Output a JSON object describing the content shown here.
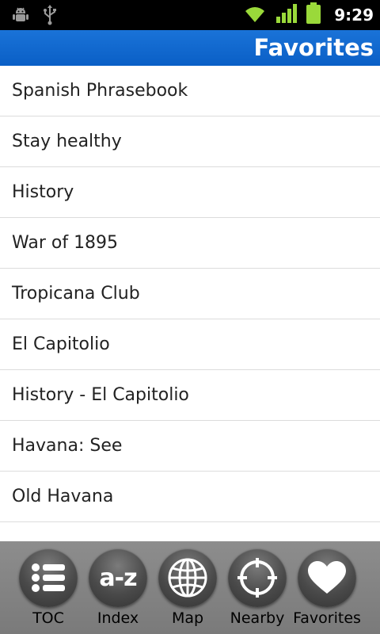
{
  "status_bar": {
    "time": "9:29",
    "icons_left": [
      "android-debug-icon",
      "usb-icon"
    ],
    "icons_right": [
      "wifi-icon",
      "signal-icon",
      "battery-icon"
    ]
  },
  "header": {
    "title": "Favorites"
  },
  "favorites": [
    "Spanish Phrasebook",
    "Stay healthy",
    "History",
    "War of 1895",
    "Tropicana Club",
    "El Capitolio",
    "History - El Capitolio",
    "Havana: See",
    "Old Havana"
  ],
  "toolbar": {
    "toc": "TOC",
    "index": "Index",
    "index_icon_text": "a-z",
    "map": "Map",
    "nearby": "Nearby",
    "favorites": "Favorites"
  },
  "colors": {
    "title_bar": "#0a5fc6",
    "status_bar": "#000000",
    "toolbar": "#8d8d8d",
    "status_green": "#9ad93a"
  }
}
